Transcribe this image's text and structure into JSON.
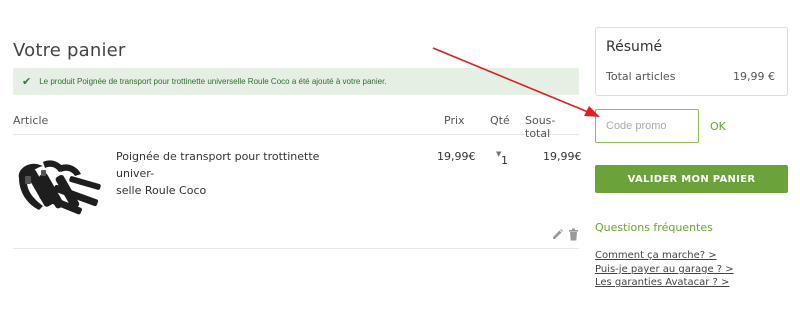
{
  "cart": {
    "title": "Votre panier",
    "alert_message": "Le produit Poignée de transport pour trottinette universelle Roule Coco a été ajouté à votre panier.",
    "columns": {
      "article": "Article",
      "prix": "Prix",
      "qte": "Qté",
      "sous_total": "Sous-total"
    },
    "items": [
      {
        "name_line1": "Poignée de transport pour trottinette univer-",
        "name_line2": "selle Roule Coco",
        "price": "19,99€",
        "qty": "1",
        "subtotal": "19,99€"
      }
    ]
  },
  "summary": {
    "title": "Résumé",
    "total_label": "Total articles",
    "total_value": "19,99 €"
  },
  "promo": {
    "placeholder": "Code promo",
    "ok_label": "OK"
  },
  "validate_label": "VALIDER MON PANIER",
  "faq": {
    "title": "Questions fréquentes",
    "links": [
      "Comment ça marche? >",
      "Puis-je payer au garage ? >",
      "Les garanties Avatacar ? >"
    ]
  },
  "colors": {
    "accent_green": "#6ba33a",
    "alert_bg": "#e6efe4",
    "arrow_red": "#e02020"
  },
  "icons": [
    "check-icon",
    "pencil-icon",
    "trash-icon",
    "sort-caret-icon"
  ]
}
